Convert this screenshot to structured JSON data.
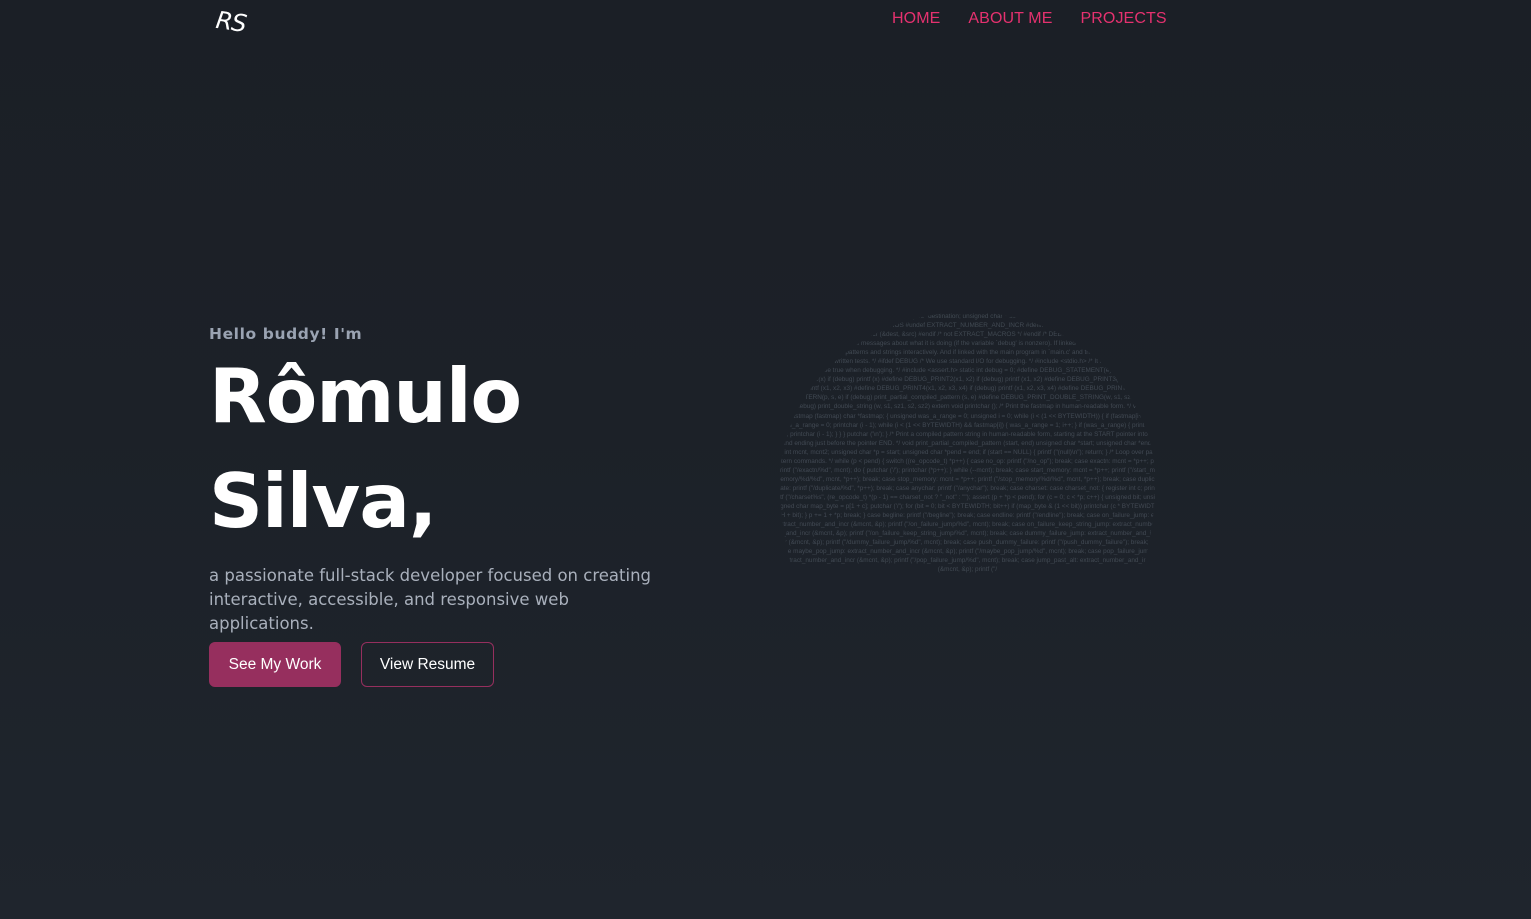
{
  "header": {
    "logo_text": "RS",
    "nav": [
      {
        "label": "HOME"
      },
      {
        "label": "ABOUT ME"
      },
      {
        "label": "PROJECTS"
      }
    ]
  },
  "hero": {
    "greeting": "Hello buddy! I'm",
    "name_line1": "Rômulo",
    "name_line2": "Silva,",
    "tagline": "a passionate full-stack developer focused on creating interactive, accessible, and responsive web applications.",
    "primary_button": "See My Work",
    "secondary_button": "View Resume"
  },
  "colors": {
    "accent": "#e5316f",
    "button_bg": "#962f5e",
    "background": "#1c2128"
  },
  "decoration": {
    "code_portrait_text": "extract_num ber_and_incr (destination, source) int *destination; unsigned char **source; { extract_num ber (destination, *source); *source += 2; } #ifndef EXTRACT_MAC ROS #undef EXTRACT_NUMBER_AND_INCR #define EXTRACT_NUM BER_AND_INCR(dest, src) extract_number_and_incr (&dest, &src) #endif /* not EXTRACT_MACROS */ #endif /* DEBUG */ /* If DEBUG is defined, Regex prints many voluminous messages about what it is doing (if the variable `debug' is nonzero). If linked with the main program in `iregex.c', you can enter patterns and strings interactively. And if linked with the main program in `main.c' and the other test files, you can run the already-written tests. */ #ifdef DEBUG /* We use standard I/O for debugging. */ #include <stdio.h> /* It is useful to test things that ``must'' be true when debugging. */ #include <assert.h> static int debug = 0; #define DEBUG_STATEMENT(e) e #define DEBUG_PRINT1(x) if (debug) printf (x) #define DEBUG_PRINT2(x1, x2) if (debug) printf (x1, x2) #define DEBUG_PRINT3(x1, x2, x3) if (debug) printf (x1, x2, x3) #define DEBUG_PRINT4(x1, x2, x3, x4) if (debug) printf (x1, x2, x3, x4) #define DEBUG_PRINT_COMPILED_PATTERN(p, s, e) if (debug) print_partial_compiled_pattern (s, e) #define DEBUG_PRINT_DOUBLE_STRING(w, s1, sz1, s2, sz2) if (debug) print_double_string (w, s1, sz1, s2, sz2) extern void printchar (); /* Print the fastmap in human-readable form. */ void print_fastmap (fastmap) char *fastmap; { unsigned was_a_range = 0; unsigned i = 0; while (i < (1 << BYTEWIDTH)) { if (fastmap[i++]) { was_a_range = 0; printchar (i - 1); while (i < (1 << BYTEWIDTH) && fastmap[i]) { was_a_range = 1; i++; } if (was_a_range) { printf (\"-\"); printchar (i - 1); } } } putchar ('\\n'); } /* Print a compiled pattern string in human-readable form, starting at the START pointer into it and ending just before the pointer END. */ void print_partial_compiled_pattern (start, end) unsigned char *start; unsigned char *end; { int mcnt, mcnt2; unsigned char *p = start; unsigned char *pend = end; if (start == NULL) { printf (\"(null)\\n\"); return; } /* Loop over pattern commands. */ while (p < pend) { switch ((re_opcode_t) *p++) { case no_op: printf (\"/no_op\"); break; case exactn: mcnt = *p++; printf (\"/exactn/%d\", mcnt); do { putchar ('/'); printchar (*p++); } while (--mcnt); break; case start_memory: mcnt = *p++; printf (\"/start_memory/%d/%d\", mcnt, *p++); break; case stop_memory: mcnt = *p++; printf (\"/stop_memory/%d/%d\", mcnt, *p++); break; case duplicate: printf (\"/duplicate/%d\", *p++); break; case anychar: printf (\"/anychar\"); break; case charset: case charset_not: { register int c; printf (\"/charset%s\", (re_opcode_t) *(p - 1) == charset_not ? \"_not\" : \"\"); assert (p + *p < pend); for (c = 0; c < *p; c++) { unsigned bit; unsigned char map_byte = p[1 + c]; putchar ('/'); for (bit = 0; bit < BYTEWIDTH; bit++) if (map_byte & (1 << bit)) printchar (c * BYTEWIDTH + bit); } p += 1 + *p; break; } case begline: printf (\"/begline\"); break; case endline: printf (\"/endline\"); break; case on_failure_jump: extract_number_and_incr (&mcnt, &p); printf (\"/on_failure_jump/%d\", mcnt); break; case on_failure_keep_string_jump: extract_number_and_incr (&mcnt, &p); printf (\"/on_failure_keep_string_jump/%d\", mcnt); break; case dummy_failure_jump: extract_number_and_incr (&mcnt, &p); printf (\"/dummy_failure_jump/%d\", mcnt); break; case push_dummy_failure: printf (\"/push_dummy_failure\"); break; case maybe_pop_jump: extract_number_and_incr (&mcnt, &p); printf (\"/maybe_pop_jump/%d\", mcnt); break; case pop_failure_jump: extract_number_and_incr (&mcnt, &p); printf (\"/pop_failure_jump/%d\", mcnt); break; case jump_past_alt: extract_number_and_incr (&mcnt, &p); printf (\"/"
  }
}
